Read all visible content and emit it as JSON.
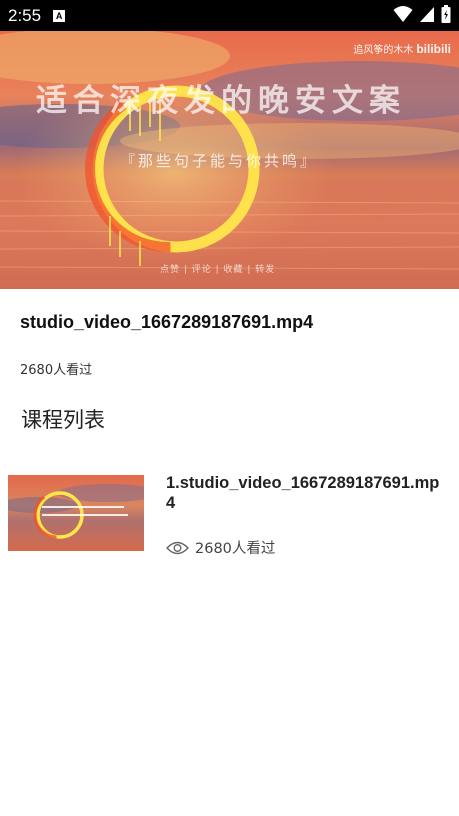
{
  "status_bar": {
    "time": "2:55",
    "notification_icon": "A"
  },
  "hero": {
    "title": "适合深夜发的晚安文案",
    "subtitle": "『那些句子能与你共鸣』",
    "watermark_author": "追风筝的木木",
    "watermark_brand": "bilibili",
    "bottom_text": "点赞 | 评论 | 收藏 | 转发"
  },
  "video": {
    "title": "studio_video_1667289187691.mp4",
    "views": "2680人看过"
  },
  "section": {
    "title": "课程列表"
  },
  "course_list": [
    {
      "title": "1.studio_video_1667289187691.mp4",
      "views": "2680人看过",
      "icon": "eye-icon"
    }
  ],
  "colors": {
    "status_bar": "#000000",
    "background": "#ffffff",
    "text_primary": "#222222"
  }
}
